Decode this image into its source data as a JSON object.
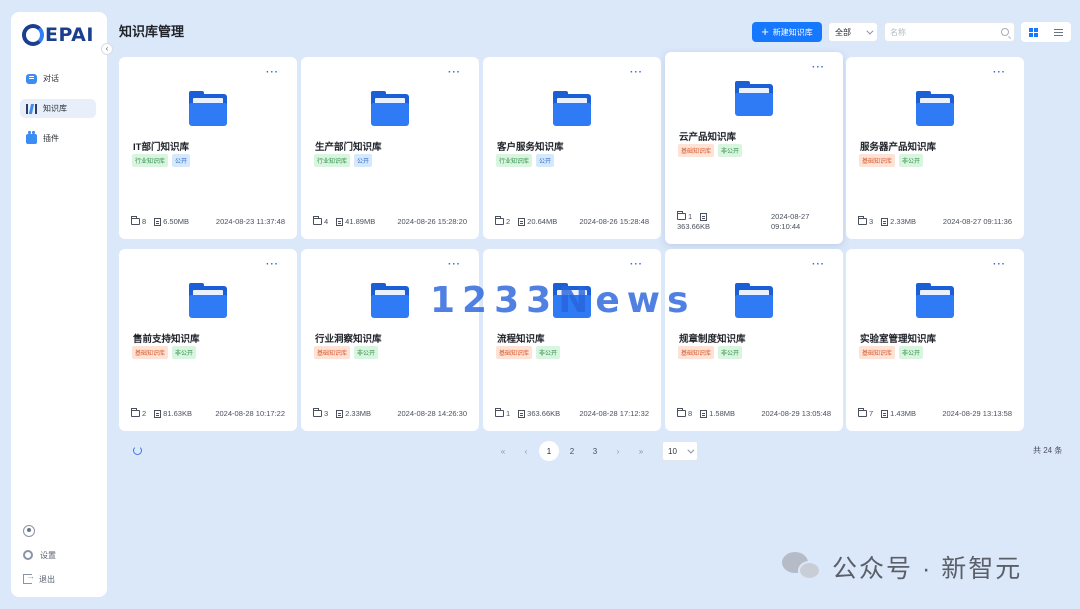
{
  "brand": {
    "logo_text": "EPAI",
    "logo_mark": "C"
  },
  "sidebar": {
    "collapse_icon": "chevron-left-icon",
    "items": [
      {
        "label": "对话",
        "icon": "chat-icon"
      },
      {
        "label": "知识库",
        "icon": "knowledge-base-icon",
        "active": true
      },
      {
        "label": "插件",
        "icon": "plugin-icon"
      }
    ],
    "bottom": [
      {
        "label": "",
        "icon": "user-avatar-icon"
      },
      {
        "label": "设置",
        "icon": "gear-icon"
      },
      {
        "label": "退出",
        "icon": "logout-icon"
      }
    ]
  },
  "header": {
    "title": "知识库管理",
    "new_button_label": "新建知识库",
    "filter_value": "全部",
    "search_placeholder": "名称",
    "search_value": ""
  },
  "cards": [
    {
      "title": "IT部门知识库",
      "tags": [
        {
          "text": "行业知识库",
          "color": "green"
        },
        {
          "text": "公开",
          "color": "blue"
        }
      ],
      "folders": "8",
      "size": "6.50MB",
      "date": "2024-08-23 11:37:48"
    },
    {
      "title": "生产部门知识库",
      "tags": [
        {
          "text": "行业知识库",
          "color": "green"
        },
        {
          "text": "公开",
          "color": "blue"
        }
      ],
      "folders": "4",
      "size": "41.89MB",
      "date": "2024-08-26 15:28:20"
    },
    {
      "title": "客户服务知识库",
      "tags": [
        {
          "text": "行业知识库",
          "color": "green"
        },
        {
          "text": "公开",
          "color": "blue"
        }
      ],
      "folders": "2",
      "size": "20.64MB",
      "date": "2024-08-26 15:28:48"
    },
    {
      "title": "云产品知识库",
      "tags": [
        {
          "text": "基础知识库",
          "color": "orange"
        },
        {
          "text": "非公开",
          "color": "green"
        }
      ],
      "folders": "1",
      "size": "363.66KB",
      "date": "2024-08-27 09:10:44",
      "date_line1": "2024-08-27",
      "date_line2": "09:10:44",
      "raised": true
    },
    {
      "title": "服务器产品知识库",
      "tags": [
        {
          "text": "基础知识库",
          "color": "orange"
        },
        {
          "text": "非公开",
          "color": "green"
        }
      ],
      "folders": "3",
      "size": "2.33MB",
      "date": "2024-08-27 09:11:36"
    },
    {
      "title": "售前支持知识库",
      "tags": [
        {
          "text": "基础知识库",
          "color": "orange"
        },
        {
          "text": "非公开",
          "color": "green"
        }
      ],
      "folders": "2",
      "size": "81.63KB",
      "date": "2024-08-28 10:17:22"
    },
    {
      "title": "行业洞察知识库",
      "tags": [
        {
          "text": "基础知识库",
          "color": "orange"
        },
        {
          "text": "非公开",
          "color": "green"
        }
      ],
      "folders": "3",
      "size": "2.33MB",
      "date": "2024-08-28 14:26:30"
    },
    {
      "title": "流程知识库",
      "tags": [
        {
          "text": "基础知识库",
          "color": "orange"
        },
        {
          "text": "非公开",
          "color": "green"
        }
      ],
      "folders": "1",
      "size": "363.66KB",
      "date": "2024-08-28 17:12:32"
    },
    {
      "title": "规章制度知识库",
      "tags": [
        {
          "text": "基础知识库",
          "color": "orange"
        },
        {
          "text": "非公开",
          "color": "green"
        }
      ],
      "folders": "8",
      "size": "1.58MB",
      "date": "2024-08-29 13:05:48"
    },
    {
      "title": "实验室管理知识库",
      "tags": [
        {
          "text": "基础知识库",
          "color": "orange"
        },
        {
          "text": "非公开",
          "color": "green"
        }
      ],
      "folders": "7",
      "size": "1.43MB",
      "date": "2024-08-29 13:13:58"
    }
  ],
  "pagination": {
    "first": "«",
    "prev": "‹",
    "next": "›",
    "last": "»",
    "pages": [
      "1",
      "2",
      "3"
    ],
    "current": "1",
    "page_size": "10",
    "total_text": "共 24 条"
  },
  "watermarks": {
    "center": "1233News",
    "wechat": "公众号 · 新智元"
  },
  "colors": {
    "primary": "#1677ff",
    "background": "#dbe8fa",
    "folder": "#2f7bf5"
  }
}
